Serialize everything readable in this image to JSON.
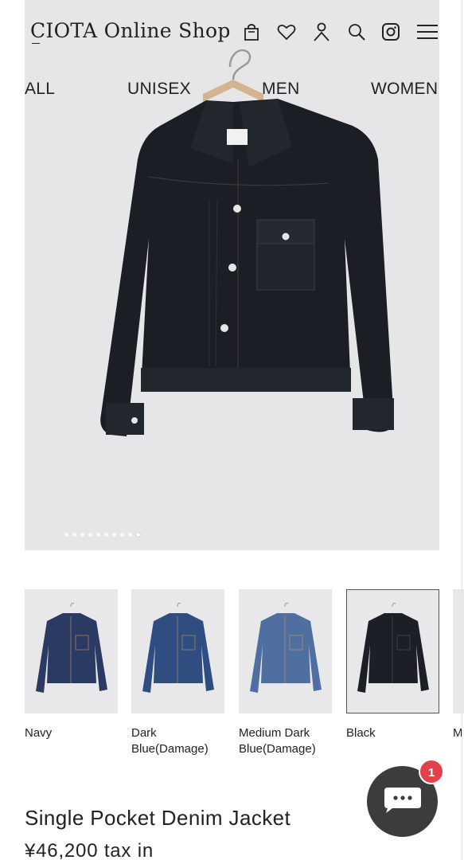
{
  "header": {
    "brand": "CIOTA Online Shop",
    "icons": [
      "bag-icon",
      "heart-icon",
      "account-icon",
      "search-icon",
      "instagram-icon",
      "menu-icon"
    ]
  },
  "categories": [
    {
      "label": "ALL"
    },
    {
      "label": "UNISEX"
    },
    {
      "label": "MEN"
    },
    {
      "label": "WOMEN"
    }
  ],
  "gallery": {
    "total_slides": 10,
    "active_slide": 10
  },
  "variants": [
    {
      "label": "Navy",
      "color": "#2a3a63",
      "selected": false
    },
    {
      "label": "Dark Blue(Damage)",
      "color": "#2f4d80",
      "selected": false
    },
    {
      "label": "Medium Dark Blue(Damage)",
      "color": "#4e6fa0",
      "selected": false
    },
    {
      "label": "Black",
      "color": "#1c1f25",
      "selected": true
    },
    {
      "label": "M",
      "color": "#e8e8ea",
      "selected": false
    }
  ],
  "product": {
    "title": "Single Pocket Denim Jacket",
    "price": "¥46,200  tax in"
  },
  "chat": {
    "unread_count": "1"
  },
  "colors": {
    "hero_bg": "#e6e6e8",
    "jacket": "#1b1e24",
    "chat_button": "#3c3c3c",
    "badge": "#e2414b"
  }
}
